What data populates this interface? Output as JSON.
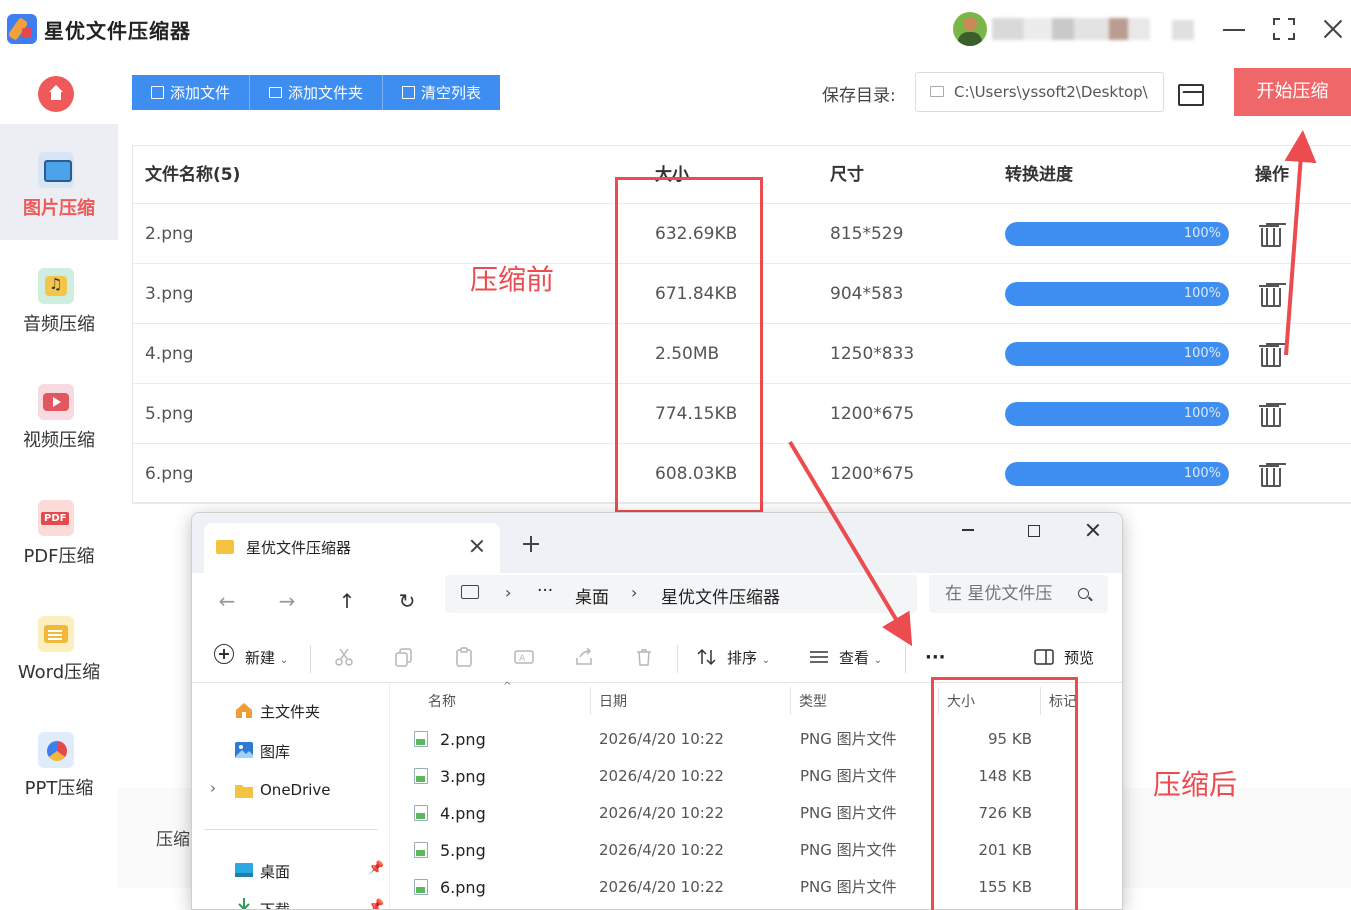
{
  "app": {
    "title": "星优文件压缩器",
    "window_controls": [
      "minimize-icon",
      "maximize-icon",
      "close-icon"
    ]
  },
  "sidebar": {
    "items": [
      {
        "label": "图片压缩",
        "icon": "image-icon",
        "active": true
      },
      {
        "label": "音频压缩",
        "icon": "audio-icon",
        "active": false
      },
      {
        "label": "视频压缩",
        "icon": "video-icon",
        "active": false
      },
      {
        "label": "PDF压缩",
        "icon": "pdf-icon",
        "active": false
      },
      {
        "label": "Word压缩",
        "icon": "word-icon",
        "active": false
      },
      {
        "label": "PPT压缩",
        "icon": "ppt-icon",
        "active": false
      }
    ]
  },
  "toolbar": {
    "add_file": "添加文件",
    "add_folder": "添加文件夹",
    "clear_list": "清空列表",
    "save_label": "保存目录:",
    "save_path": "C:\\Users\\yssoft2\\Desktop\\",
    "start": "开始压缩"
  },
  "table": {
    "headers": {
      "name": "文件名称(5)",
      "size": "大小",
      "dimensions": "尺寸",
      "progress": "转换进度",
      "actions": "操作"
    },
    "rows": [
      {
        "name": "2.png",
        "size": "632.69KB",
        "dimensions": "815*529",
        "progress": "100%",
        "progress_value": 100
      },
      {
        "name": "3.png",
        "size": "671.84KB",
        "dimensions": "904*583",
        "progress": "100%",
        "progress_value": 100
      },
      {
        "name": "4.png",
        "size": "2.50MB",
        "dimensions": "1250*833",
        "progress": "100%",
        "progress_value": 100
      },
      {
        "name": "5.png",
        "size": "774.15KB",
        "dimensions": "1200*675",
        "progress": "100%",
        "progress_value": 100
      },
      {
        "name": "6.png",
        "size": "608.03KB",
        "dimensions": "1200*675",
        "progress": "100%",
        "progress_value": 100
      }
    ]
  },
  "bottom": {
    "label": "压缩"
  },
  "annotations": {
    "before": "压缩前",
    "after": "压缩后",
    "color": "#ec4b4f"
  },
  "explorer": {
    "tab_title": "星优文件压缩器",
    "breadcrumb": [
      "桌面",
      "星优文件压缩器"
    ],
    "breadcrumb_ellipsis": "···",
    "search_placeholder": "在 星优文件压",
    "commands": {
      "new": "新建",
      "sort": "排序",
      "view": "查看",
      "more": "···",
      "preview": "预览"
    },
    "nav": {
      "home": "主文件夹",
      "gallery": "图库",
      "onedrive": "OneDrive",
      "desktop": "桌面",
      "downloads": "下载"
    },
    "columns": {
      "name": "名称",
      "date": "日期",
      "type": "类型",
      "size": "大小",
      "tag": "标记"
    },
    "files": [
      {
        "name": "2.png",
        "date": "2026/4/20 10:22",
        "type": "PNG 图片文件",
        "size": "95 KB"
      },
      {
        "name": "3.png",
        "date": "2026/4/20 10:22",
        "type": "PNG 图片文件",
        "size": "148 KB"
      },
      {
        "name": "4.png",
        "date": "2026/4/20 10:22",
        "type": "PNG 图片文件",
        "size": "726 KB"
      },
      {
        "name": "5.png",
        "date": "2026/4/20 10:22",
        "type": "PNG 图片文件",
        "size": "201 KB"
      },
      {
        "name": "6.png",
        "date": "2026/4/20 10:22",
        "type": "PNG 图片文件",
        "size": "155 KB"
      }
    ]
  },
  "colors": {
    "accent": "#3d8ef0",
    "start_button": "#f0676a",
    "active_nav": "#ee5a5a"
  }
}
